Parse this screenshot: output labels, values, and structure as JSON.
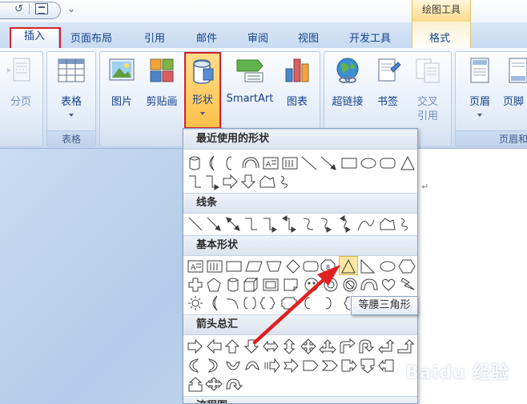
{
  "contextual_tab": {
    "header": "绘图工具",
    "tab": "格式"
  },
  "tabs": [
    {
      "label": "插入",
      "active": true
    },
    {
      "label": "页面布局"
    },
    {
      "label": "引用"
    },
    {
      "label": "邮件"
    },
    {
      "label": "审阅"
    },
    {
      "label": "视图"
    },
    {
      "label": "开发工具"
    }
  ],
  "ribbon": {
    "page_break": {
      "label": "分页"
    },
    "table": {
      "label": "表格",
      "group": "表格"
    },
    "picture": {
      "label": "图片"
    },
    "clipart": {
      "label": "剪贴画"
    },
    "shapes": {
      "label": "形状",
      "selected": true
    },
    "smartart": {
      "label": "SmartArt"
    },
    "chart": {
      "label": "图表"
    },
    "hyperlink": {
      "label": "超链接"
    },
    "bookmark": {
      "label": "书签"
    },
    "cross_reference": {
      "label_line1": "交叉",
      "label_line2": "引用"
    },
    "header": {
      "label": "页眉"
    },
    "footer": {
      "label": "页脚"
    },
    "header_footer_group": "页眉和"
  },
  "gallery": {
    "categories": [
      "最近使用的形状",
      "线条",
      "基本形状",
      "箭头总汇",
      "流程图"
    ]
  },
  "tooltip": "等腰三角形",
  "colors": {
    "accent": "#d5212e",
    "ribbon_text": "#15428b",
    "selected_fill": "#ffc04a"
  }
}
